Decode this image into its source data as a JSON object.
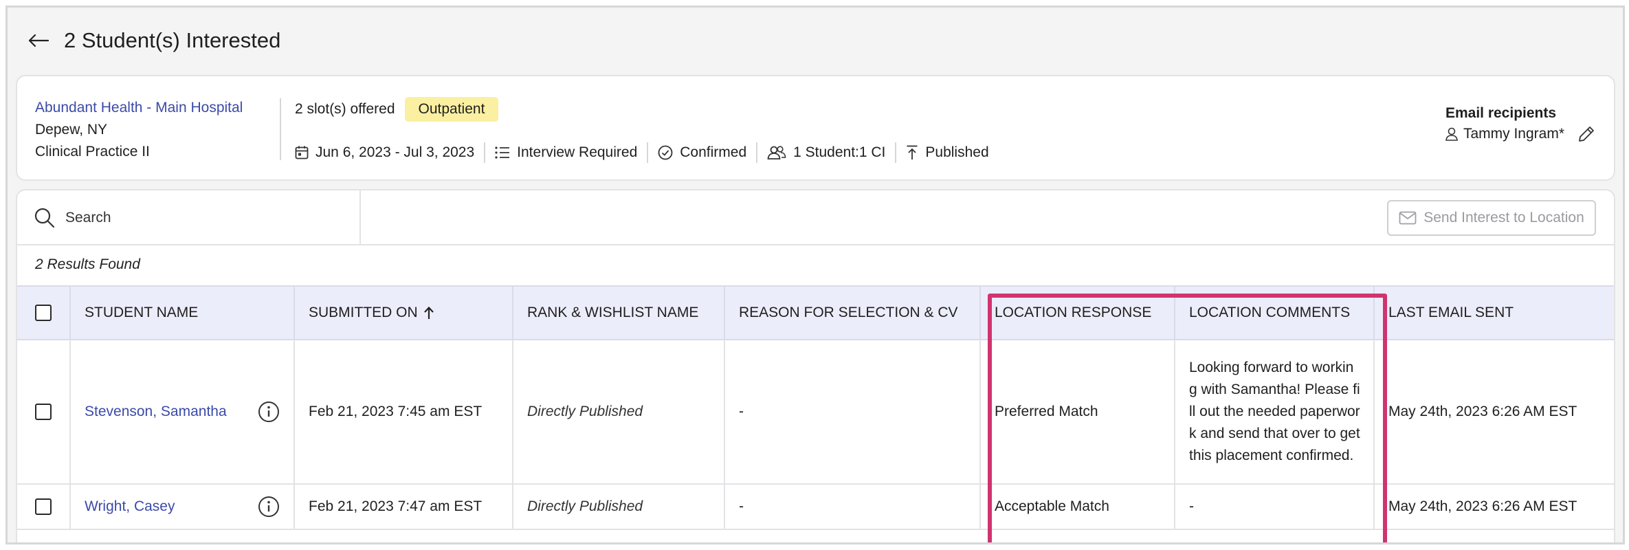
{
  "header": {
    "title": "2 Student(s) Interested"
  },
  "placement": {
    "site_name": "Abundant Health - Main Hospital",
    "location": "Depew, NY",
    "course": "Clinical Practice II",
    "slots_offered": "2 slot(s) offered",
    "setting_badge": "Outpatient",
    "dates": "Jun 6, 2023 - Jul 3, 2023",
    "interview": "Interview Required",
    "status": "Confirmed",
    "ratio": "1 Student:1 CI",
    "publish_state": "Published",
    "email_recipients_title": "Email recipients",
    "email_recipient": "Tammy Ingram*"
  },
  "toolbar": {
    "search_placeholder": "Search",
    "send_button_label": "Send Interest to Location"
  },
  "results_text": "2 Results Found",
  "table": {
    "columns": [
      "Student Name",
      "Submitted On",
      "Rank & Wishlist Name",
      "Reason for Selection & CV",
      "Location Response",
      "Location Comments",
      "Last Email Sent"
    ],
    "sort_column": "Submitted On",
    "sort_direction": "ascending",
    "rows": [
      {
        "student": "Stevenson, Samantha",
        "submitted": "Feb 21, 2023 7:45 am EST",
        "rank": "Directly Published",
        "reason": "-",
        "response": "Preferred Match",
        "comments": "Looking forward to working with Samantha! Please fill out the needed paperwork and send that over to get this placement confirmed.",
        "last_email": "May 24th, 2023 6:26 AM EST"
      },
      {
        "student": "Wright, Casey",
        "submitted": "Feb 21, 2023 7:47 am EST",
        "rank": "Directly Published",
        "reason": "-",
        "response": "Acceptable Match",
        "comments": "-",
        "last_email": "May 24th, 2023 6:26 AM EST"
      }
    ]
  },
  "colors": {
    "link": "#3b4aa8",
    "badge_bg": "#fbf0a1",
    "header_bg": "#ecedfa",
    "highlight": "#d1336f"
  },
  "icons": [
    "back-arrow-icon",
    "calendar-icon",
    "list-icon",
    "check-circle-icon",
    "users-icon",
    "publish-icon",
    "user-icon",
    "pencil-icon",
    "search-icon",
    "mail-icon",
    "sort-up-icon",
    "info-icon"
  ]
}
